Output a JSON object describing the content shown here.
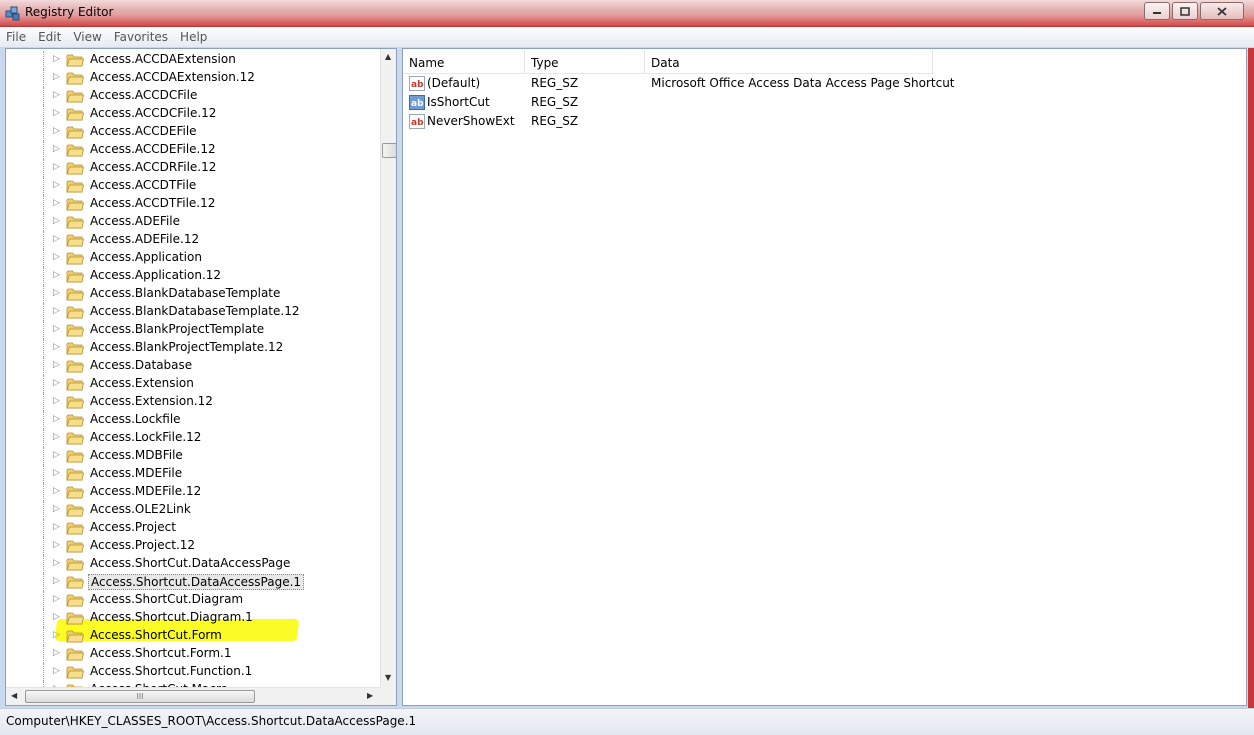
{
  "window": {
    "title": "Registry Editor",
    "controls": [
      "minimize",
      "maximize",
      "close"
    ]
  },
  "menu": [
    "File",
    "Edit",
    "View",
    "Favorites",
    "Help"
  ],
  "tree": {
    "items": [
      "Access.ACCDAExtension",
      "Access.ACCDAExtension.12",
      "Access.ACCDCFile",
      "Access.ACCDCFile.12",
      "Access.ACCDEFile",
      "Access.ACCDEFile.12",
      "Access.ACCDRFile.12",
      "Access.ACCDTFile",
      "Access.ACCDTFile.12",
      "Access.ADEFile",
      "Access.ADEFile.12",
      "Access.Application",
      "Access.Application.12",
      "Access.BlankDatabaseTemplate",
      "Access.BlankDatabaseTemplate.12",
      "Access.BlankProjectTemplate",
      "Access.BlankProjectTemplate.12",
      "Access.Database",
      "Access.Extension",
      "Access.Extension.12",
      "Access.Lockfile",
      "Access.LockFile.12",
      "Access.MDBFile",
      "Access.MDEFile",
      "Access.MDEFile.12",
      "Access.OLE2Link",
      "Access.Project",
      "Access.Project.12",
      "Access.ShortCut.DataAccessPage",
      "Access.Shortcut.DataAccessPage.1",
      "Access.ShortCut.Diagram",
      "Access.Shortcut.Diagram.1",
      "Access.ShortCut.Form",
      "Access.Shortcut.Form.1",
      "Access.Shortcut.Function.1",
      "Access.ShortCut.Macro"
    ],
    "selected_index": 29,
    "hscroll_grip": "III"
  },
  "values": {
    "columns": [
      "Name",
      "Type",
      "Data"
    ],
    "rows": [
      {
        "name": "(Default)",
        "type": "REG_SZ",
        "data": "Microsoft Office Access Data Access Page Shortcut",
        "icon": "string-value-icon"
      },
      {
        "name": "IsShortCut",
        "type": "REG_SZ",
        "data": "",
        "icon": "string-value-icon"
      },
      {
        "name": "NeverShowExt",
        "type": "REG_SZ",
        "data": "",
        "icon": "string-value-icon"
      }
    ]
  },
  "status": {
    "path": "Computer\\HKEY_CLASSES_ROOT\\Access.Shortcut.DataAccessPage.1"
  },
  "colors": {
    "highlight": "#f5f500",
    "titlebar": "#e39a9a",
    "folder": "#e8c35c"
  }
}
